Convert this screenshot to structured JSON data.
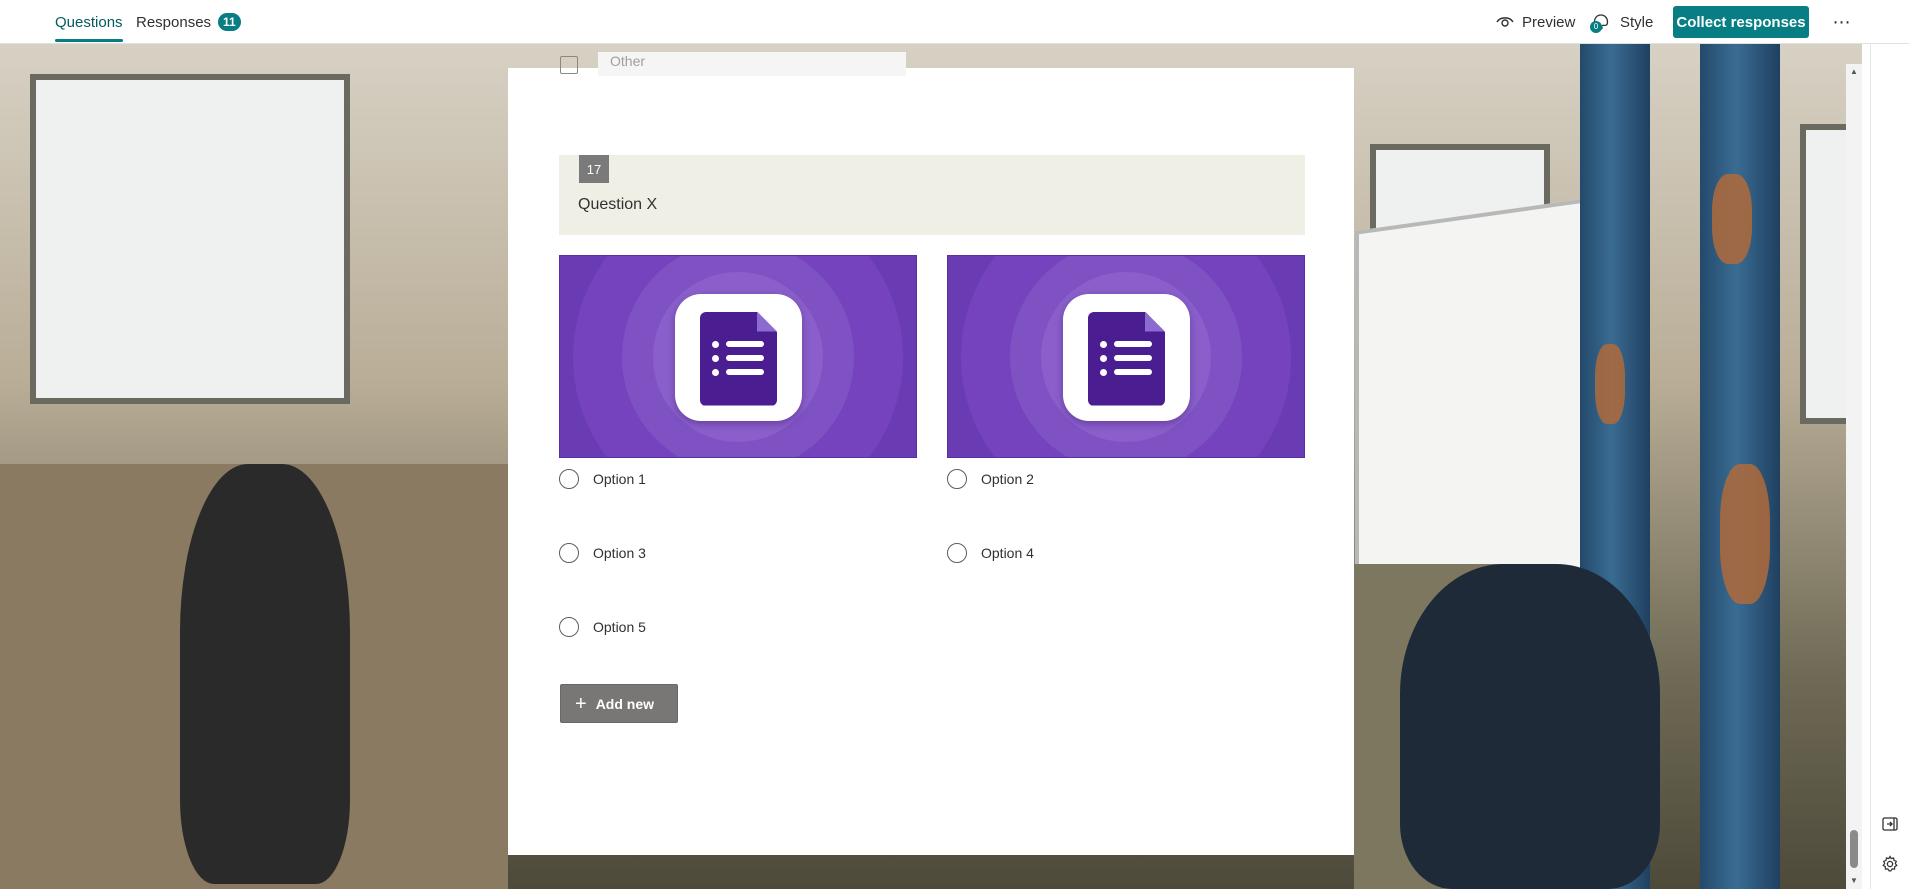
{
  "header": {
    "tabs": [
      {
        "label": "Questions",
        "active": true
      },
      {
        "label": "Responses",
        "badge": "11"
      }
    ],
    "preview_label": "Preview",
    "style_label": "Style",
    "style_badge": "0",
    "collect_label": "Collect responses",
    "more_icon": "more-icon"
  },
  "previous_question": {
    "other_placeholder": "Other"
  },
  "question": {
    "number": "17",
    "title": "Question X",
    "options": [
      {
        "label": "Option 1",
        "image": "forms-icon"
      },
      {
        "label": "Option 2",
        "image": "forms-icon"
      },
      {
        "label": "Option 3"
      },
      {
        "label": "Option 4"
      },
      {
        "label": "Option 5"
      }
    ],
    "add_new_label": "Add new"
  },
  "colors": {
    "accent": "#077d84",
    "option_image_bg": "#6a3cb3",
    "question_header_bg": "#f0efe6",
    "add_button_bg": "#797775"
  }
}
